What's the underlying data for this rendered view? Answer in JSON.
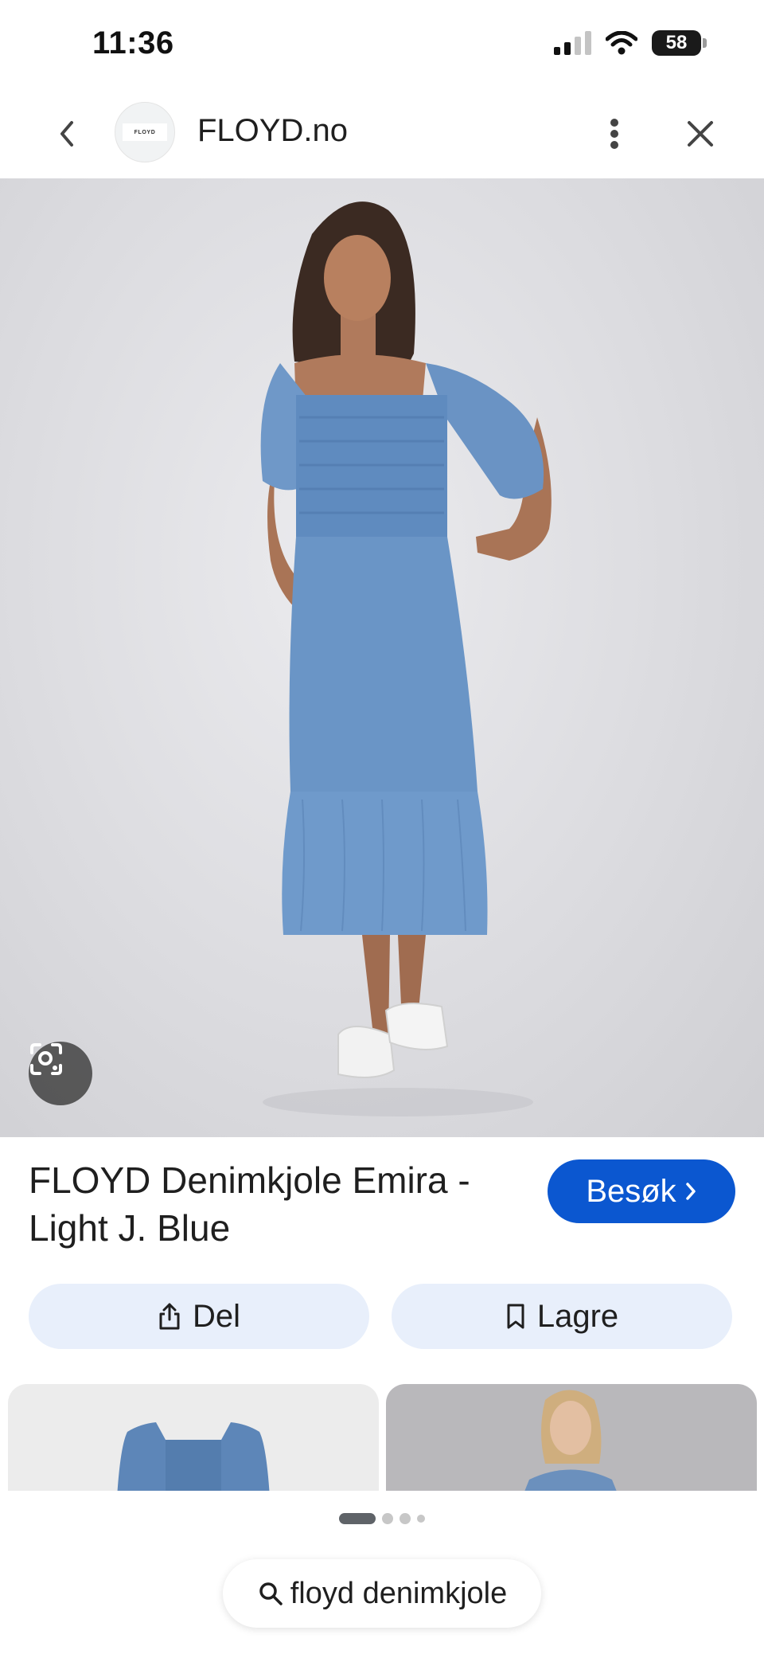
{
  "status_bar": {
    "time": "11:36",
    "battery_level": "58"
  },
  "header": {
    "site_logo_text": "FLOYD",
    "site_title": "FLOYD.no"
  },
  "hero": {
    "lens_icon": "google-lens-icon"
  },
  "product": {
    "title": "FLOYD Denimkjole Emira - Light J. Blue",
    "visit_label": "Besøk",
    "share_label": "Del",
    "save_label": "Lagre"
  },
  "carousel": {
    "page_count": 4,
    "active_page": 1
  },
  "search": {
    "query": "floyd denimkjole"
  },
  "colors": {
    "accent": "#0b57d0",
    "chip_background": "#e8effb",
    "dress_blue": "#6a95c6"
  }
}
